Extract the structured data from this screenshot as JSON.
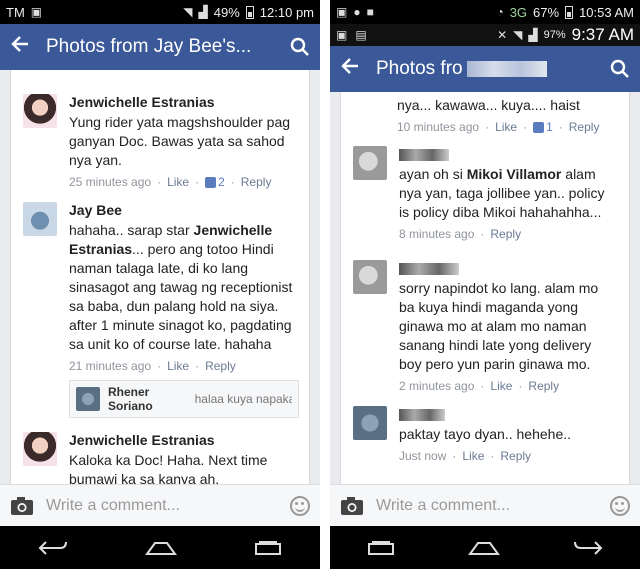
{
  "left": {
    "status": {
      "carrier": "TM",
      "battery": "49%",
      "time": "12:10 pm"
    },
    "appbar": {
      "title": "Photos from Jay Bee's..."
    },
    "comments": [
      {
        "author": "Jenwichelle Estranias",
        "text": "Yung rider yata magshshoulder pag ganyan Doc. Bawas yata sa sahod nya yan.",
        "time": "25 minutes ago",
        "like": "Like",
        "likes": "2",
        "reply": "Reply"
      },
      {
        "author": "Jay Bee",
        "text_a": "hahaha.. sarap star ",
        "mention": "Jenwichelle Estranias",
        "text_b": "... pero ang totoo Hindi naman talaga late, di ko lang sinasagot ang tawag ng receptionist sa baba, dun palang hold na siya. after 1 minute sinagot ko, pagdating sa unit ko of course late. hahaha",
        "time": "21 minutes ago",
        "like": "Like",
        "reply": "Reply",
        "sub_reply": {
          "author": "Rhener Soriano",
          "text": "halaa kuya napaka..."
        }
      },
      {
        "author": "Jenwichelle Estranias",
        "text": "Kaloka ka Doc! Haha. Next time bumawi ka sa kanya ah,"
      }
    ],
    "composer": {
      "placeholder": "Write a comment..."
    }
  },
  "right": {
    "status": {
      "network": "3G",
      "battery": "67%",
      "time": "10:53 AM",
      "battery2": "97%",
      "time2": "9:37 AM"
    },
    "appbar": {
      "title": "Photos fro"
    },
    "comments": [
      {
        "text": "nya... kawawa... kuya.... haist",
        "time": "10 minutes ago",
        "like": "Like",
        "likes": "1",
        "reply": "Reply"
      },
      {
        "text_a": "ayan oh si ",
        "mention": "Mikoi Villamor",
        "text_b": " alam nya yan, taga jollibee yan.. policy is policy diba Mikoi hahahahha...",
        "time": "8 minutes ago",
        "reply": "Reply"
      },
      {
        "text": "sorry napindot ko lang.  alam mo ba kuya hindi maganda yong ginawa mo at alam mo naman sanang hindi late yong delivery boy pero yun parin ginawa mo.",
        "time": "2 minutes ago",
        "like": "Like",
        "reply": "Reply"
      },
      {
        "text": "paktay tayo dyan..  hehehe..",
        "time": "Just now",
        "like": "Like",
        "reply": "Reply"
      }
    ],
    "composer": {
      "placeholder": "Write a comment..."
    }
  },
  "icons": [
    "back-arrow-icon",
    "search-icon",
    "camera-icon",
    "smiley-icon",
    "nav-back-icon",
    "nav-home-icon",
    "nav-recents-icon"
  ],
  "colors": {
    "facebook_blue": "#3b5998",
    "feed_bg": "#e9ebee",
    "meta_grey": "#90949c"
  }
}
